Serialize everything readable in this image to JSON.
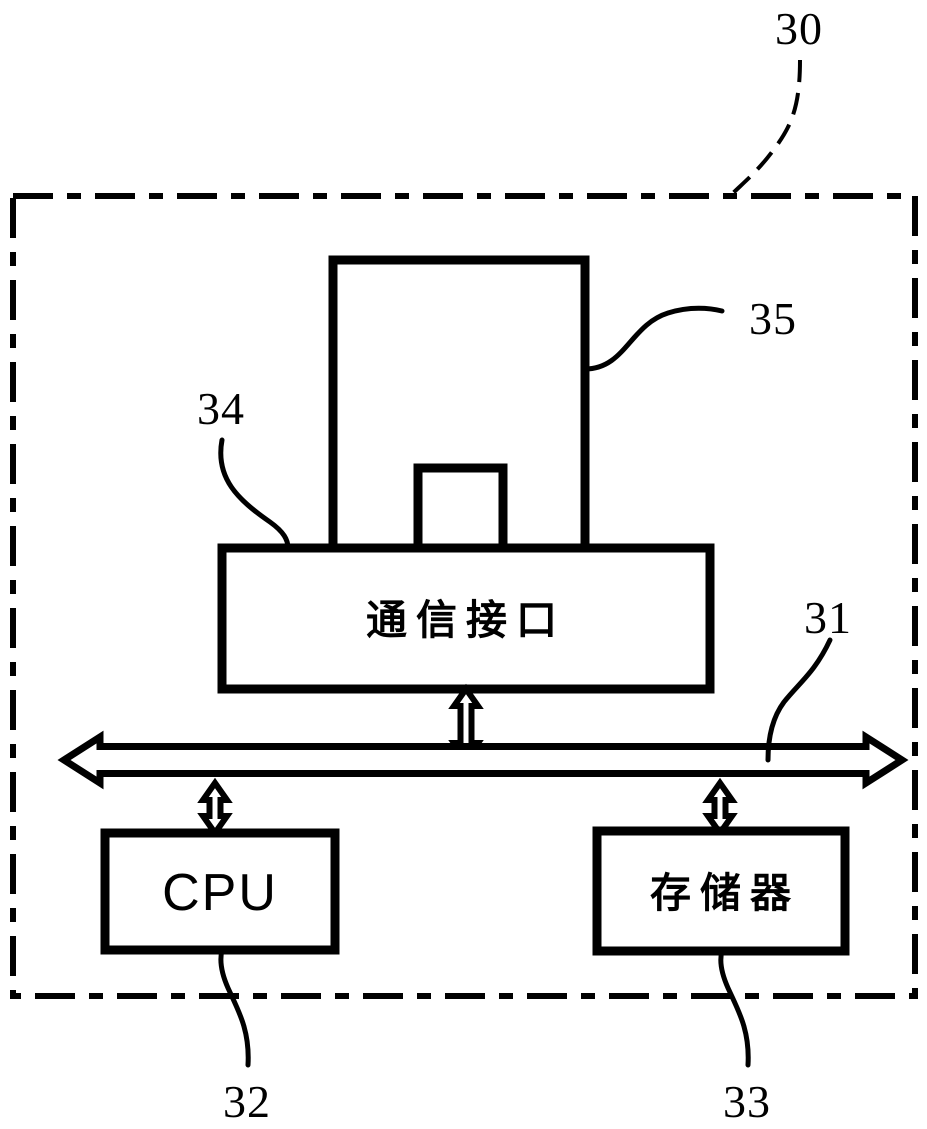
{
  "figure": {
    "type": "patent-block-diagram",
    "background_color": "#ffffff",
    "line_color": "#000000"
  },
  "enclosure": {
    "name": "device-boundary",
    "style": "dash-dot",
    "reference_numeral": "30"
  },
  "blocks": {
    "antenna": {
      "label": "",
      "reference_numeral": "35"
    },
    "communication_interface": {
      "label": "通信接口",
      "reference_numeral": "34"
    },
    "cpu": {
      "label": "CPU",
      "reference_numeral": "32"
    },
    "memory": {
      "label": "存储器",
      "reference_numeral": "33"
    },
    "bus": {
      "label": "",
      "reference_numeral": "31"
    }
  },
  "reference_numerals": {
    "enclosure": "30",
    "bus": "31",
    "cpu": "32",
    "memory": "33",
    "communication_interface": "34",
    "antenna": "35"
  }
}
